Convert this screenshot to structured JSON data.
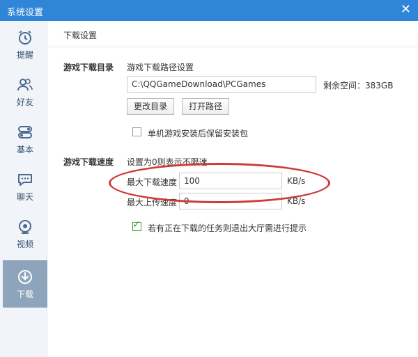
{
  "window": {
    "title": "系统设置",
    "close_glyph": "✕"
  },
  "sidebar": {
    "items": [
      {
        "label": "提醒",
        "icon": "alarm-clock-icon",
        "active": false
      },
      {
        "label": "好友",
        "icon": "friends-icon",
        "active": false
      },
      {
        "label": "基本",
        "icon": "toggle-switch-icon",
        "active": false
      },
      {
        "label": "聊天",
        "icon": "chat-bubble-icon",
        "active": false
      },
      {
        "label": "视频",
        "icon": "camera-icon",
        "active": false
      },
      {
        "label": "下载",
        "icon": "download-icon",
        "active": true
      }
    ]
  },
  "main": {
    "header": "下载设置",
    "dir_section": {
      "label": "游戏下载目录",
      "sublabel": "游戏下载路径设置",
      "path_value": "C:\\QQGameDownload\\PCGames",
      "free_space": "剩余空间：383GB",
      "change_button": "更改目录",
      "open_button": "打开路径",
      "keep_package_label": "单机游戏安装后保留安装包",
      "keep_package_checked": false
    },
    "speed_section": {
      "label": "游戏下载速度",
      "hint": "设置为0则表示不限速",
      "max_download_label": "最大下载速度",
      "max_download_value": "100",
      "max_download_unit": "KB/s",
      "max_upload_label": "最大上传速度",
      "max_upload_value": "0",
      "max_upload_unit": "KB/s",
      "exit_prompt_label": "若有正在下载的任务则退出大厅需进行提示",
      "exit_prompt_checked": true
    }
  },
  "colors": {
    "titlebar": "#2f86d8",
    "sidebar_active": "#8ea4bd",
    "annotation": "#cf3a3a"
  }
}
